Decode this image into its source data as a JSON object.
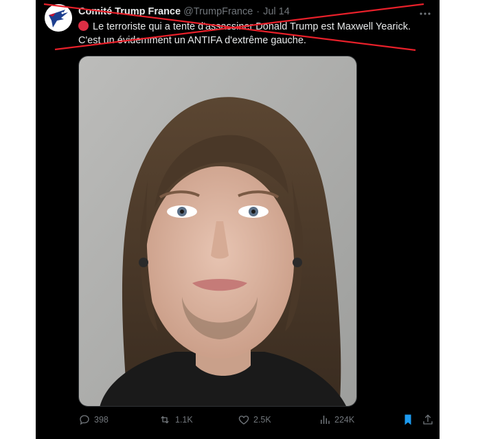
{
  "tweet": {
    "display_name": "Comité Trump France",
    "handle": "@TrumpFrance",
    "separator": "·",
    "date": "Jul 14",
    "text_line1": "Le terroriste qui a tenté d'assassiner Donald Trump est Maxwell Yearick.",
    "text_line2": "C'est un évidemment un ANTIFA d'extrême gauche.",
    "emoji": "red-circle"
  },
  "actions": {
    "replies": "398",
    "retweets": "1.1K",
    "likes": "2.5K",
    "views": "224K"
  },
  "icons": {
    "reply": "reply-icon",
    "retweet": "retweet-icon",
    "like": "heart-icon",
    "views": "views-icon",
    "bookmark": "bookmark-icon",
    "share": "share-icon",
    "more": "more-icon"
  },
  "colors": {
    "background": "#000000",
    "text": "#e7e9ea",
    "muted": "#71767b",
    "bookmark_active": "#1d9bf0",
    "strike_red": "#e8202a"
  }
}
